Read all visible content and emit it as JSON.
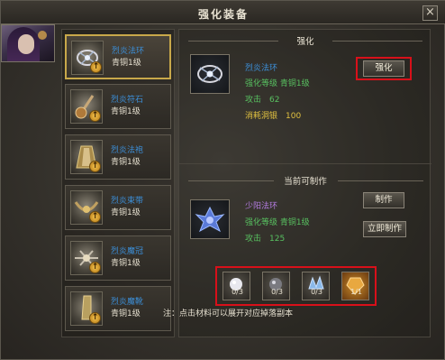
{
  "window": {
    "title": "强化装备",
    "close_label": "×"
  },
  "equipment_list": [
    {
      "name": "烈炎法环",
      "level": "青铜1级",
      "selected": true,
      "icon": "ring-icon"
    },
    {
      "name": "烈炎符石",
      "level": "青铜1级",
      "selected": false,
      "icon": "talisman-icon"
    },
    {
      "name": "烈炎法袍",
      "level": "青铜1级",
      "selected": false,
      "icon": "robe-icon"
    },
    {
      "name": "烈炎束带",
      "level": "青铜1级",
      "selected": false,
      "icon": "belt-icon"
    },
    {
      "name": "烈炎魔冠",
      "level": "青铜1级",
      "selected": false,
      "icon": "crown-icon"
    },
    {
      "name": "烈炎魔靴",
      "level": "青铜1级",
      "selected": false,
      "icon": "boots-icon"
    }
  ],
  "enhance": {
    "header": "强化",
    "item_name": "烈炎法环",
    "enhance_level": "强化等级 青铜1级",
    "attack": "攻击　62",
    "cost": "消耗洞银　100",
    "button": "强化"
  },
  "craft": {
    "header": "当前可制作",
    "item_name": "少阳法环",
    "enhance_level": "强化等级 青铜1级",
    "attack": "攻击　125",
    "make_button": "制作",
    "instant_button": "立即制作"
  },
  "materials": [
    {
      "count": "0/3",
      "icon": "white-orb-icon"
    },
    {
      "count": "0/3",
      "icon": "dark-orb-icon"
    },
    {
      "count": "0/3",
      "icon": "crystal-icon"
    },
    {
      "count": "1/1",
      "icon": "gold-token-icon"
    }
  ],
  "note": "注：点击材料可以展开对应掉落副本",
  "colors": {
    "name_blue": "#3c8fd8",
    "stat_green": "#58c060",
    "cost_yellow": "#e0c040",
    "highlight_red": "#d8101a",
    "selected_gold": "#c8a84a"
  }
}
